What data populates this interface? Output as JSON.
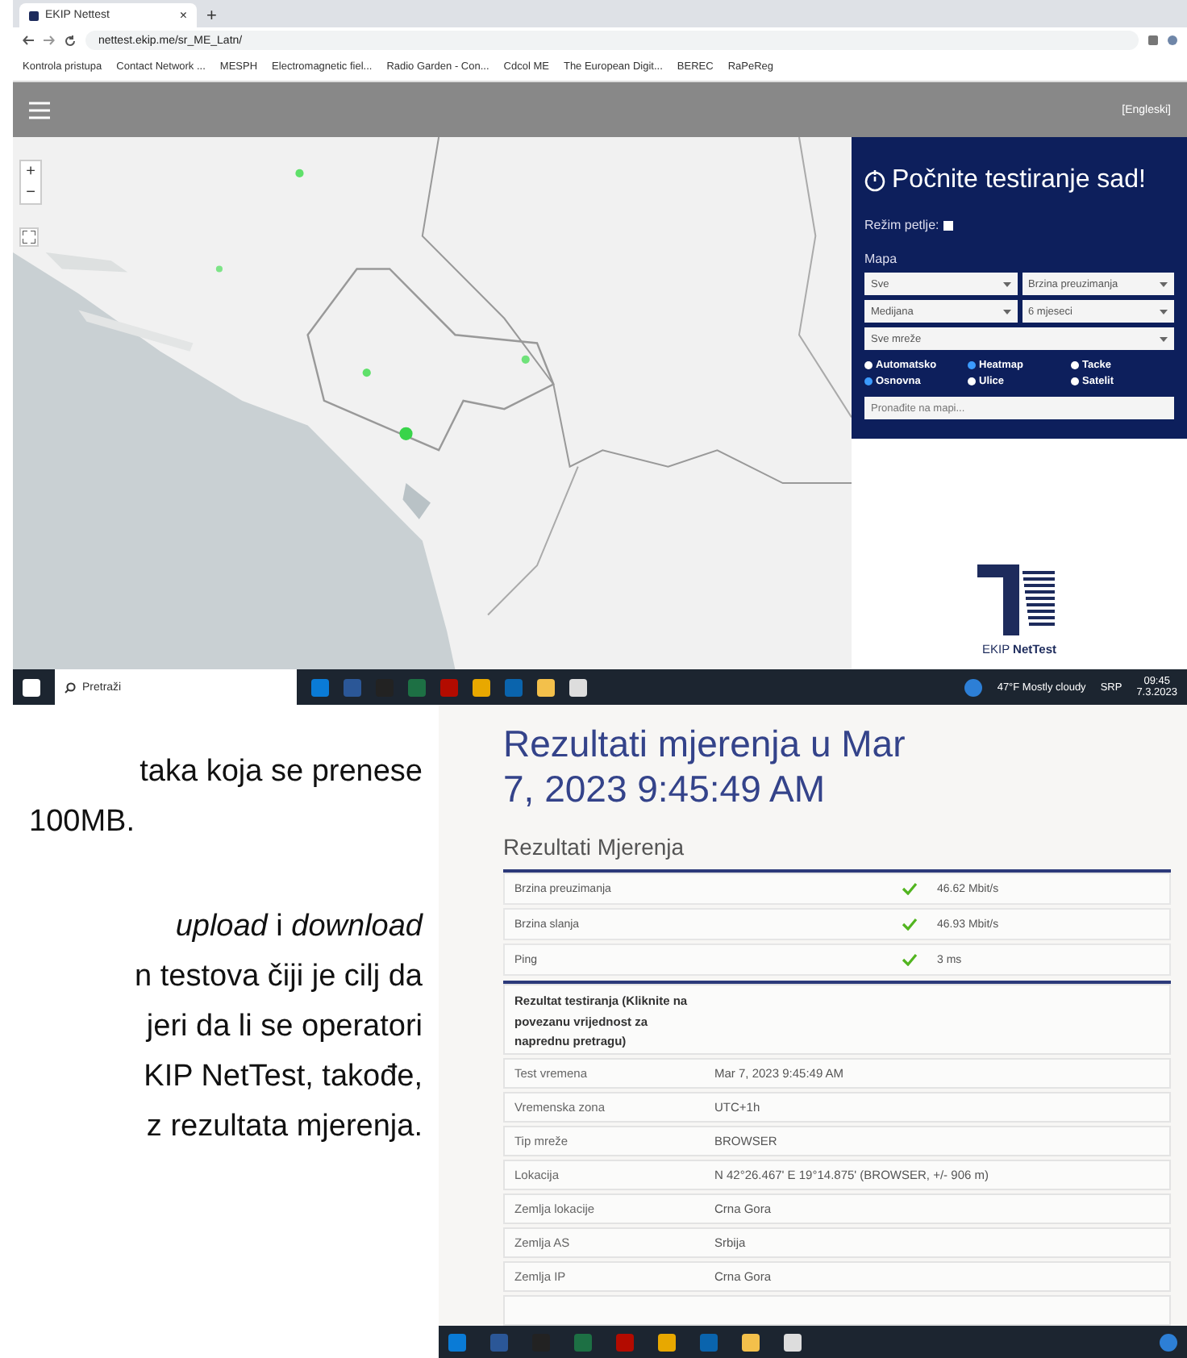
{
  "browser": {
    "tab": {
      "title": "EKIP Nettest",
      "close": "×",
      "new": "+"
    },
    "url": "nettest.ekip.me/sr_ME_Latn/",
    "bookmarks": [
      "Kontrola pristupa",
      "Contact Network ...",
      "MESPH",
      "Electromagnetic fiel...",
      "Radio Garden - Con...",
      "Cdcol ME",
      "The European Digit...",
      "BEREC",
      "RaPeReg"
    ],
    "header": {
      "language": "[Engleski]"
    },
    "map": {
      "zoom_in": "+",
      "zoom_out": "−"
    },
    "panel": {
      "title": "Počnite testiranje sad!",
      "loop_label": "Režim petlje:",
      "loop_checked": false,
      "map_label": "Mapa",
      "selects": [
        {
          "value": "Sve",
          "wide": false
        },
        {
          "value": "Brzina preuzimanja",
          "wide": false
        },
        {
          "value": "Medijana",
          "wide": false
        },
        {
          "value": "6 mjeseci",
          "wide": false
        },
        {
          "value": "Sve mreže",
          "wide": true
        }
      ],
      "radios": [
        {
          "label": "Automatsko",
          "selected": false
        },
        {
          "label": "Heatmap",
          "selected": true
        },
        {
          "label": "Tacke",
          "selected": false
        },
        {
          "label": "Osnovna",
          "selected": true
        },
        {
          "label": "Ulice",
          "selected": false
        },
        {
          "label": "Satelit",
          "selected": false
        }
      ],
      "search": {
        "placeholder": "Pronađite na mapi..."
      },
      "logo": "EKIP **NetTest**"
    },
    "taskbar": {
      "search": "Pretraži",
      "weather": "47°F  Mostly cloudy",
      "language": "SRP",
      "time": "09:45",
      "date": "7.3.2023"
    }
  },
  "document": {
    "paragraphs": [
      {
        "lines": [
          "taka koja se prenese",
          "100MB."
        ]
      },
      {
        "lines": [
          "*upload* i *download*",
          "n testova čiji je cilj da",
          "jeri da li se operatori",
          "KIP NetTest, takođe,",
          "z rezultata mjerenja."
        ]
      }
    ]
  },
  "results": {
    "title": "Rezultati mjerenja u Mar 7, 2023 9:45:49 AM",
    "subtitle": "Rezultati Mjerenja",
    "measurements": [
      {
        "name": "Brzina preuzimanja",
        "ok": true,
        "value": "46.62 Mbit/s"
      },
      {
        "name": "Brzina slanja",
        "ok": true,
        "value": "46.93 Mbit/s"
      },
      {
        "name": "Ping",
        "ok": true,
        "value": "3 ms"
      }
    ],
    "details_header": "Rezultat testiranja (Kliknite na povezanu vrijednost za naprednu pretragu)",
    "details": [
      {
        "name": "Test vremena",
        "value": "Mar 7, 2023 9:45:49 AM"
      },
      {
        "name": "Vremenska zona",
        "value": "UTC+1h"
      },
      {
        "name": "Tip mreže",
        "value": "BROWSER"
      },
      {
        "name": "Lokacija",
        "value": "N 42°26.467' E 19°14.875' (BROWSER, +/- 906 m)"
      },
      {
        "name": "Zemlja lokacije",
        "value": "Crna Gora"
      },
      {
        "name": "Zemlja AS",
        "value": "Srbija"
      },
      {
        "name": "Zemlja IP",
        "value": "Crna Gora"
      }
    ]
  }
}
